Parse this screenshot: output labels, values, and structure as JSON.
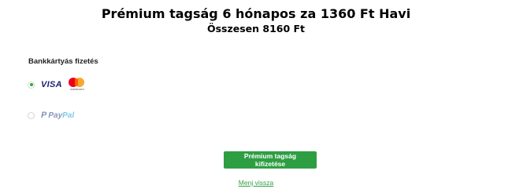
{
  "header": {
    "title": "Prémium tagság 6 hónapos za 1360 Ft Havi",
    "subtitle": "Összesen 8160 Ft"
  },
  "payment": {
    "section_label": "Bankkártyás fizetés",
    "options": [
      {
        "id": "card",
        "selected": true,
        "brands": [
          "VISA",
          "mastercard"
        ]
      },
      {
        "id": "paypal",
        "selected": false,
        "brand_a": "Pay",
        "brand_b": "Pal"
      }
    ]
  },
  "actions": {
    "pay_button": "Prémium tagság kifizetése",
    "cancel_link": "Menj vissza"
  },
  "colors": {
    "accent": "#2e9e43",
    "radio_selected": "#3aa63d"
  }
}
